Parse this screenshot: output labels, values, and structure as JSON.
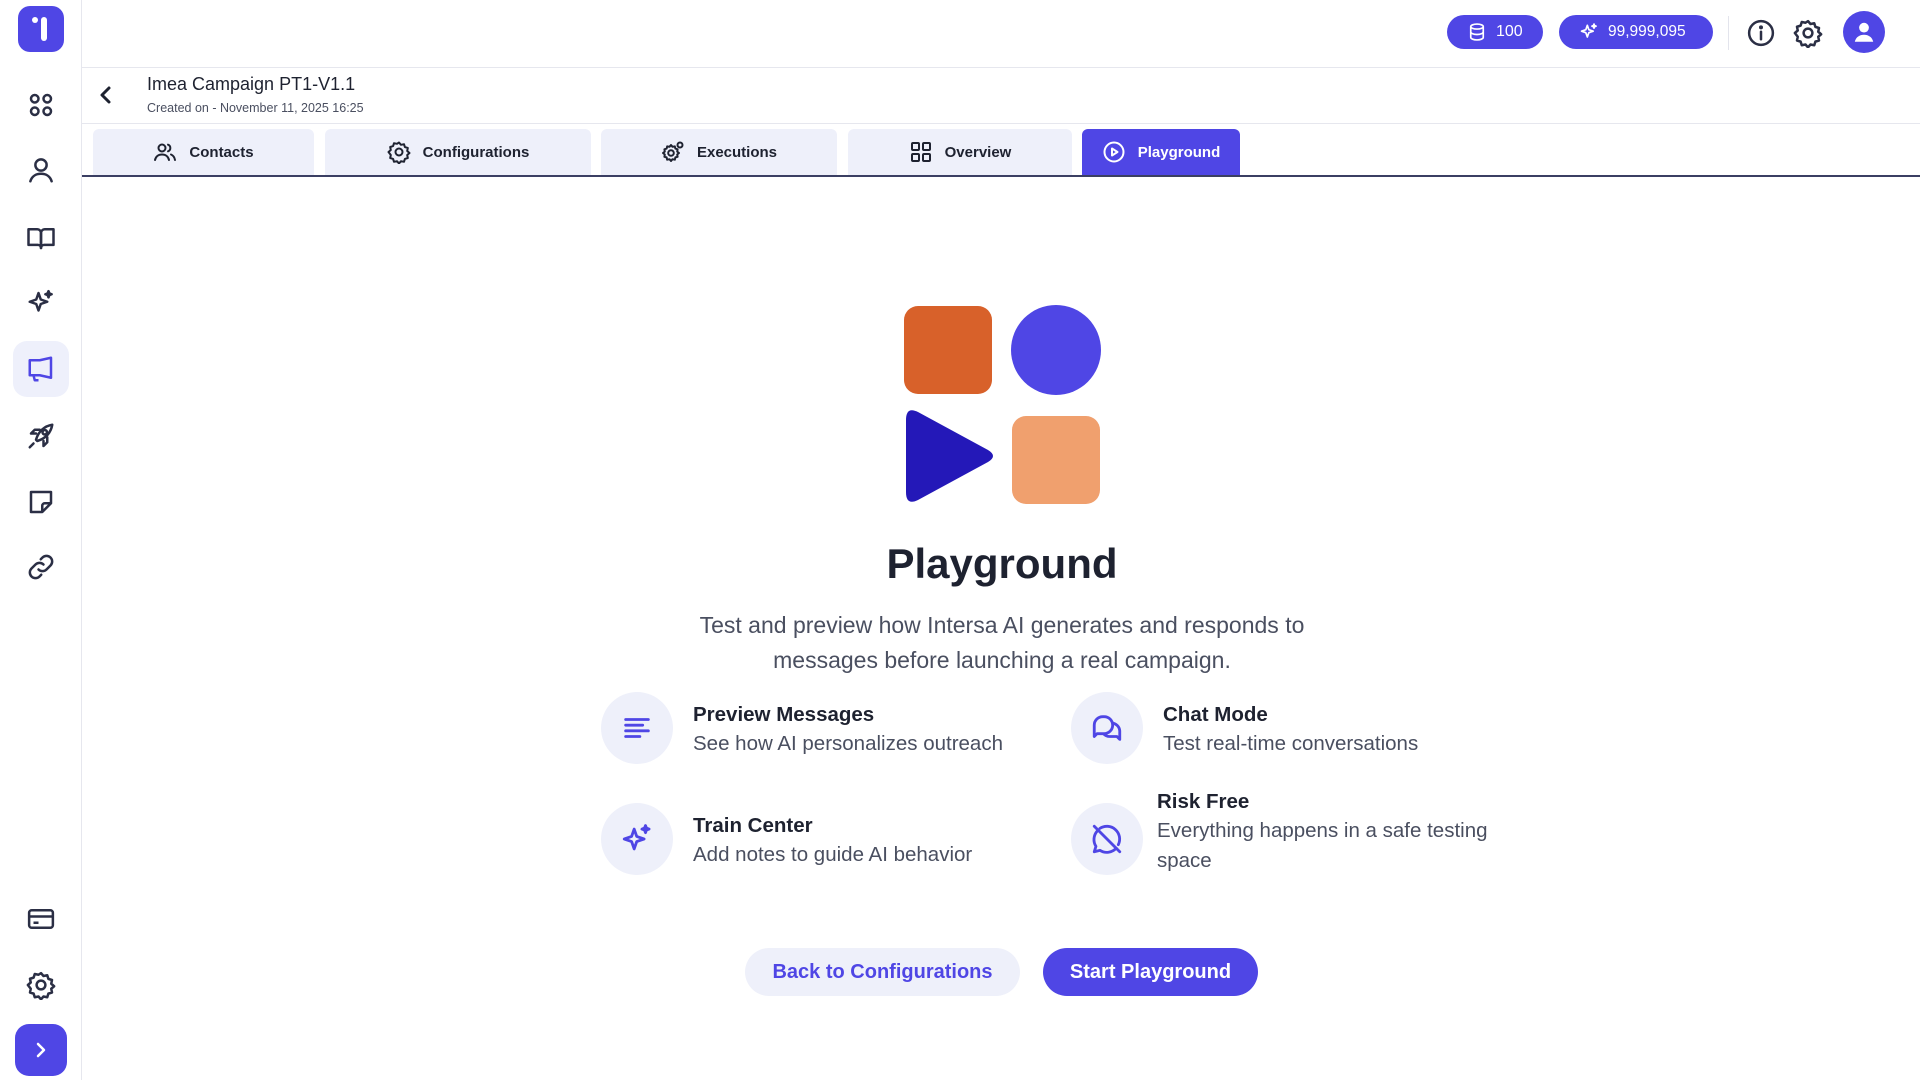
{
  "topbar": {
    "credits": "100",
    "tokens": "99,999,095",
    "credits_icon": "database-icon",
    "tokens_icon": "sparkle-icon"
  },
  "sidebar": {
    "items": [
      {
        "name": "dashboard",
        "icon": "grid-icon"
      },
      {
        "name": "contacts",
        "icon": "user-icon"
      },
      {
        "name": "knowledge",
        "icon": "book-icon"
      },
      {
        "name": "ai",
        "icon": "sparkle-icon"
      },
      {
        "name": "campaigns",
        "icon": "megaphone-icon",
        "active": true
      },
      {
        "name": "launch",
        "icon": "rocket-icon"
      },
      {
        "name": "notes",
        "icon": "sticky-note-icon"
      },
      {
        "name": "integrations",
        "icon": "link-icon"
      },
      {
        "name": "billing",
        "icon": "credit-card-icon"
      },
      {
        "name": "settings",
        "icon": "gear-icon"
      }
    ]
  },
  "header": {
    "title": "Imea Campaign PT1-V1.1",
    "subtitle": "Created on - November 11, 2025 16:25"
  },
  "tabs": [
    {
      "label": "Contacts",
      "icon": "users-icon"
    },
    {
      "label": "Configurations",
      "icon": "gear-icon"
    },
    {
      "label": "Executions",
      "icon": "gears-icon"
    },
    {
      "label": "Overview",
      "icon": "grid-icon"
    },
    {
      "label": "Playground",
      "icon": "play-circle-icon",
      "active": true
    }
  ],
  "main": {
    "title": "Playground",
    "description": "Test and preview how Intersa AI generates and responds to messages before launching a real campaign.",
    "features": [
      {
        "title": "Preview Messages",
        "description": "See how AI personalizes outreach",
        "icon": "text-lines-icon"
      },
      {
        "title": "Chat Mode",
        "description": "Test real-time conversations",
        "icon": "chat-bubbles-icon"
      },
      {
        "title": "Train Center",
        "description": "Add notes to guide AI behavior",
        "icon": "sparkle-icon"
      },
      {
        "title": "Risk Free",
        "description": "Everything happens in a safe testing space",
        "icon": "chat-off-icon"
      }
    ],
    "secondary_button": "Back to Configurations",
    "primary_button": "Start Playground"
  },
  "colors": {
    "accent": "#4f46e5",
    "accent_light": "#eef0fa",
    "orange": "#d8612a",
    "peach": "#f0a06e",
    "navy": "#2418b8"
  }
}
